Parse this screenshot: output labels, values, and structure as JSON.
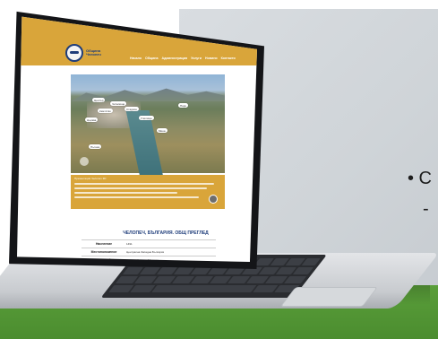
{
  "background": {
    "bullet_text": "• С",
    "dash_text": "-"
  },
  "site": {
    "logo_text": "Община Челопеч",
    "nav": [
      "Начало",
      "Община",
      "Администрация",
      "Услуги",
      "Новини",
      "Контакти"
    ],
    "hero_labels": [
      "Център",
      "Читалище",
      "Кметство",
      "Стадион",
      "Църква",
      "Училище",
      "Парк",
      "Мина",
      "Пътека"
    ],
    "description_lead": "Презентация Челопеч 3D",
    "section_title": "ЧЕЛОПЕЧ, БЪЛГАРИЯ. ОБЩ ПРЕГЛЕД",
    "table": [
      {
        "key": "Население",
        "value": "1491"
      },
      {
        "key": "Местоположение",
        "value": "Централна Западна България"
      },
      {
        "key": "Граничещи общини",
        "value": "Пирдоп, Чавдар, Мирково"
      }
    ]
  },
  "colors": {
    "accent": "#d9a53a",
    "brand_blue": "#1f3d7a",
    "ground_green": "#4b8d2f"
  }
}
